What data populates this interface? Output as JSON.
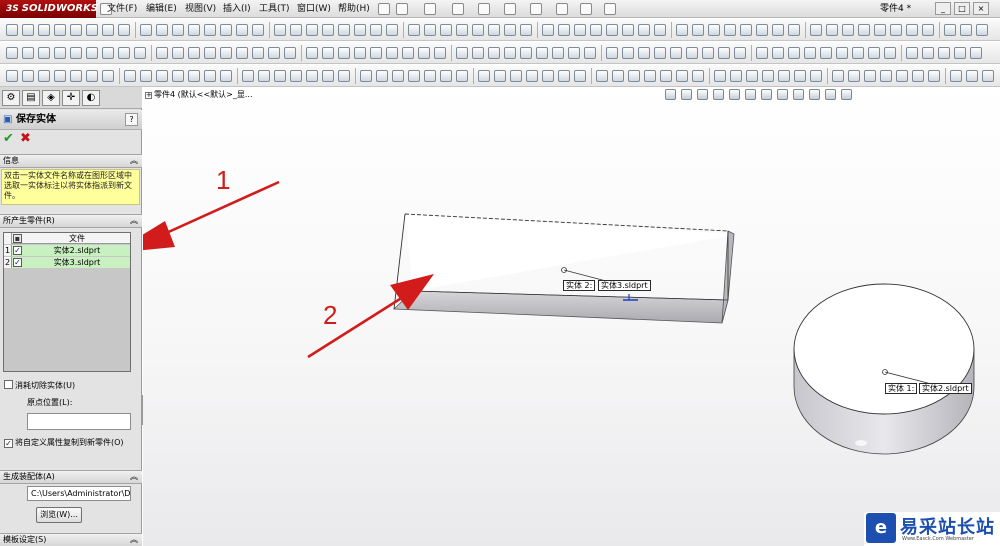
{
  "app": {
    "logo_prefix": "3S",
    "logo_text": "SOLIDWORKS",
    "document_title": "零件4 *"
  },
  "menu": [
    "文件(F)",
    "编辑(E)",
    "视图(V)",
    "插入(I)",
    "工具(T)",
    "窗口(W)",
    "帮助(H)"
  ],
  "property_manager": {
    "title": "保存实体",
    "help": "?",
    "ok_glyph": "✔",
    "cancel_glyph": "✖",
    "info": {
      "header": "信息",
      "text": "双击一实体文件名称或在图形区域中选取一实体标注以将实体指派到新文件。"
    },
    "resulting_parts": {
      "header": "所产生零件(R)",
      "column_file": "文件",
      "rows": [
        {
          "num": "1",
          "checked": true,
          "file": "实体2.sldprt"
        },
        {
          "num": "2",
          "checked": true,
          "file": "实体3.sldprt"
        }
      ]
    },
    "consume_cut_bodies": "消耗切除实体(U)",
    "origin_location_label": "原点位置(L):",
    "origin_location_value": "",
    "copy_custom_props": "将自定义属性复制到新零件(O)",
    "create_assembly": {
      "header": "生成装配体(A)",
      "path": "C:\\Users\\Administrator\\De",
      "browse": "浏览(W)..."
    },
    "template_settings_header": "模板设定(S)"
  },
  "viewport": {
    "tree_label": "零件4  (默认<<默认>_显...",
    "callouts": [
      {
        "body": "实体 2:",
        "file": "实体3.sldprt"
      },
      {
        "body": "实体 1:",
        "file": "实体2.sldprt"
      }
    ],
    "annotations": [
      "1",
      "2"
    ]
  },
  "watermark": {
    "logo": "e",
    "name": "易采站长站",
    "url": "Www.Easck.Com  Webmaster"
  },
  "colors": {
    "accent_red": "#d21c1c",
    "selected_row": "#c9f0c0",
    "info_bg": "#ffff9c",
    "watermark_blue": "#1d4fb0"
  }
}
